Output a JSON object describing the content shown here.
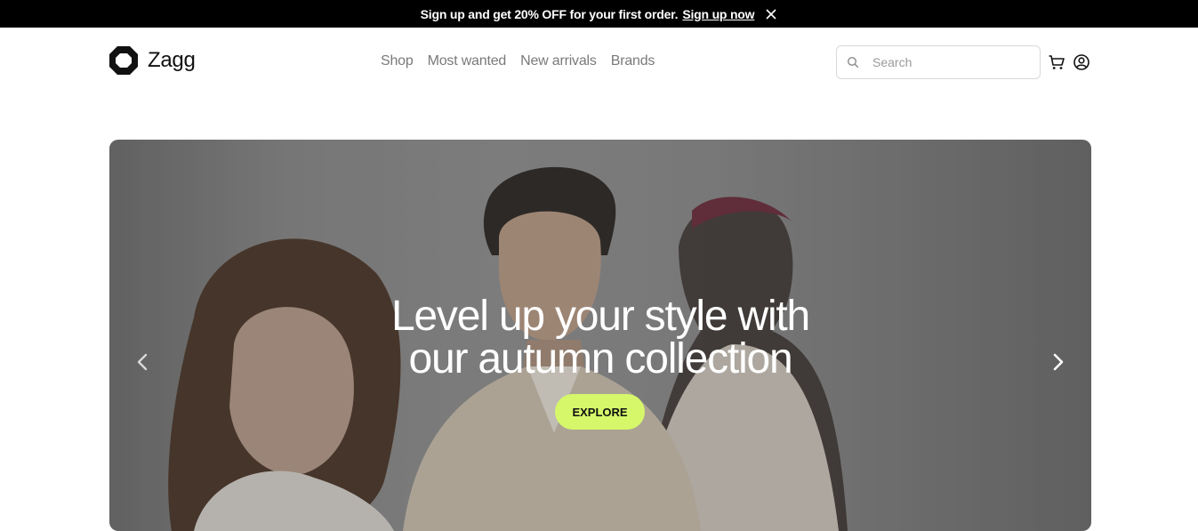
{
  "promo": {
    "text": "Sign up and get 20% OFF for your first order.",
    "link": "Sign up now",
    "close_icon": "close-icon"
  },
  "header": {
    "brand": "Zagg",
    "logo_icon": "hexagon-logo-icon",
    "nav": [
      "Shop",
      "Most wanted",
      "New arrivals",
      "Brands"
    ],
    "search_placeholder": "Search",
    "search_icon": "search-icon",
    "cart_icon": "cart-icon",
    "account_icon": "user-icon"
  },
  "hero": {
    "headline_line1": "Level up your style with",
    "headline_line2": "our autumn collection",
    "cta": "EXPLORE",
    "prev_icon": "chevron-left-icon",
    "next_icon": "chevron-right-icon"
  },
  "colors": {
    "promo_bg": "#000000",
    "cta_bg": "#d6f76a",
    "nav_text": "#7a7a7a"
  }
}
